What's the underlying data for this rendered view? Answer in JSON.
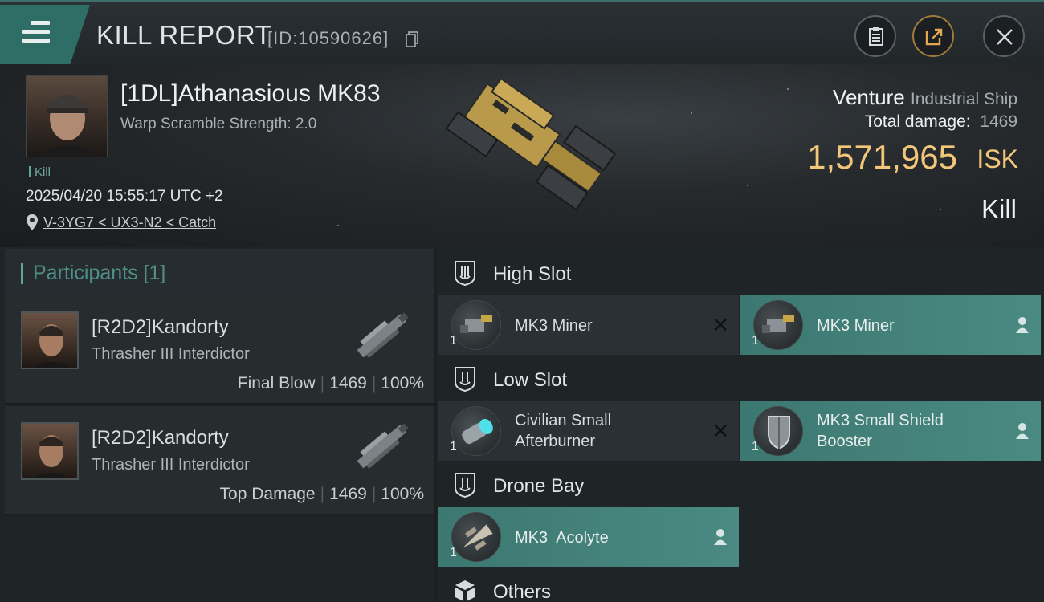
{
  "header": {
    "title": "KILL REPORT",
    "report_id": "[ID:10590626]"
  },
  "victim": {
    "name": "[1DL]Athanasious MK83",
    "subtitle": "Warp Scramble Strength: 2.0",
    "tag": "Kill",
    "timestamp": "2025/04/20 15:55:17 UTC +2",
    "location": "V-3YG7 < UX3-N2 < Catch"
  },
  "ship": {
    "name": "Venture",
    "class": "Industrial Ship",
    "total_damage_label": "Total damage:",
    "total_damage": "1469",
    "isk_value": "1,571,965",
    "isk_unit": "ISK",
    "result": "Kill"
  },
  "participants": {
    "header": "Participants [1]",
    "rows": [
      {
        "name": "[R2D2]Kandorty",
        "ship": "Thrasher III Interdictor",
        "role": "Final Blow",
        "damage": "1469",
        "percent": "100%"
      },
      {
        "name": "[R2D2]Kandorty",
        "ship": "Thrasher III Interdictor",
        "role": "Top Damage",
        "damage": "1469",
        "percent": "100%"
      }
    ]
  },
  "slots": {
    "high": {
      "title": "High Slot",
      "items": [
        {
          "name": "MK3 Miner",
          "qty": "1",
          "status": "destroyed"
        },
        {
          "name": "MK3 Miner",
          "qty": "1",
          "status": "dropped"
        }
      ]
    },
    "low": {
      "title": "Low Slot",
      "items": [
        {
          "name_line1": "Civilian Small",
          "name_line2": "Afterburner",
          "qty": "1",
          "status": "destroyed"
        },
        {
          "name_line1": "MK3 Small Shield",
          "name_line2": "Booster",
          "qty": "1",
          "status": "dropped"
        }
      ]
    },
    "drone": {
      "title": "Drone Bay",
      "items": [
        {
          "name": "MK3  Acolyte",
          "qty": "1",
          "status": "dropped"
        }
      ]
    },
    "others": {
      "title": "Others"
    }
  },
  "colors": {
    "accent_teal": "#3c7871",
    "isk_gold": "#f3c779",
    "panel_dark": "#1f2426"
  },
  "icons": [
    "menu-icon",
    "copy-icon",
    "clipboard-icon",
    "share-icon",
    "close-icon",
    "location-pin-icon",
    "slot-shield-icon",
    "cube-icon",
    "person-icon",
    "x-mark-icon"
  ]
}
